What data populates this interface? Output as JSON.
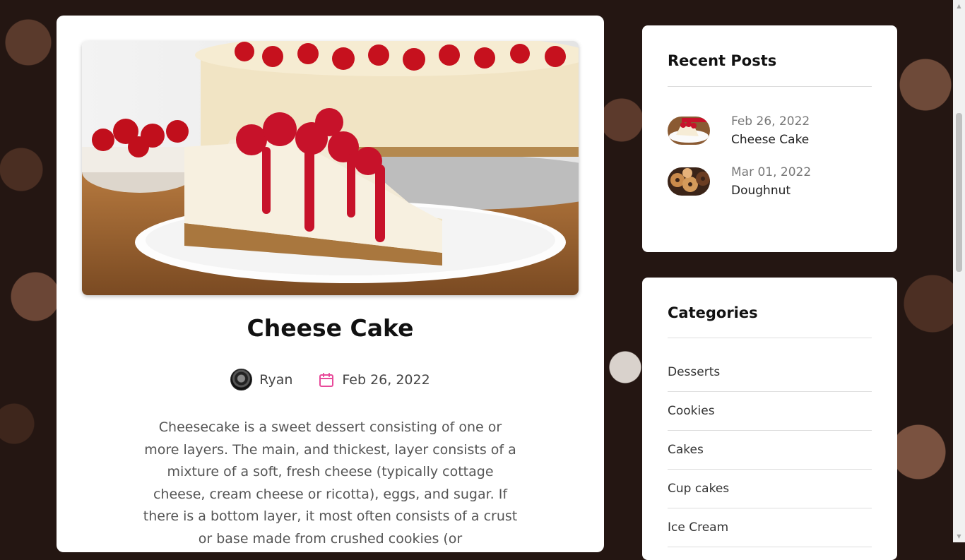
{
  "article": {
    "title": "Cheese Cake",
    "author": "Ryan",
    "date": "Feb 26, 2022",
    "body": "Cheesecake is a sweet dessert consisting of one or more layers. The main, and thickest, layer consists of a mixture of a soft, fresh cheese (typically cottage cheese, cream cheese or ricotta), eggs, and sugar. If there is a bottom layer, it most often consists of a crust or base made from crushed cookies (or"
  },
  "recent_posts": {
    "heading": "Recent Posts",
    "items": [
      {
        "date": "Feb 26, 2022",
        "title": "Cheese Cake",
        "thumb": "cheesecake-thumb"
      },
      {
        "date": "Mar 01, 2022",
        "title": "Doughnut",
        "thumb": "doughnut-thumb"
      }
    ]
  },
  "categories": {
    "heading": "Categories",
    "items": [
      "Desserts",
      "Cookies",
      "Cakes",
      "Cup cakes",
      "Ice Cream"
    ]
  },
  "colors": {
    "accent": "#e84a9a",
    "background": "#241612"
  }
}
